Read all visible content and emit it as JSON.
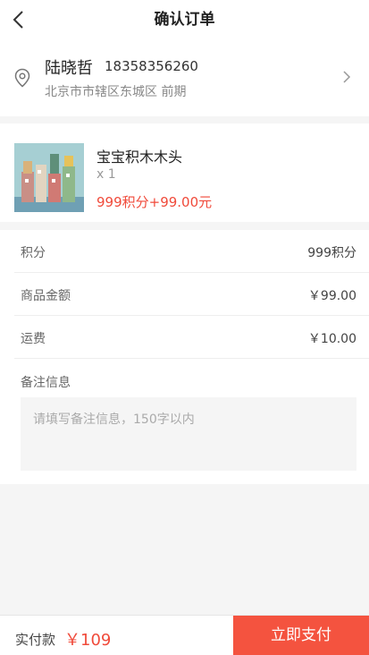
{
  "header": {
    "title": "确认订单",
    "back_icon": "back-arrow-icon"
  },
  "address": {
    "name": "陆晓哲",
    "phone": "18358356260",
    "detail": "北京市市辖区东城区 前期",
    "location_icon": "location-pin-icon",
    "chevron_icon": "chevron-right-icon"
  },
  "product": {
    "name": "宝宝积木木头",
    "quantity": "x 1",
    "price": "999积分+99.00元"
  },
  "summary": [
    {
      "label": "积分",
      "value": "999积分"
    },
    {
      "label": "商品金额",
      "value": "￥99.00"
    },
    {
      "label": "运费",
      "value": "￥10.00"
    }
  ],
  "remarks": {
    "label": "备注信息",
    "placeholder": "请填写备注信息，150字以内",
    "value": ""
  },
  "footer": {
    "pay_label": "实付款",
    "pay_amount": "￥109",
    "submit_label": "立即支付"
  },
  "colors": {
    "accent": "#f4533f",
    "price": "#f04a3a",
    "stripe_red": "#e84545",
    "stripe_blue": "#3ab0e8"
  }
}
